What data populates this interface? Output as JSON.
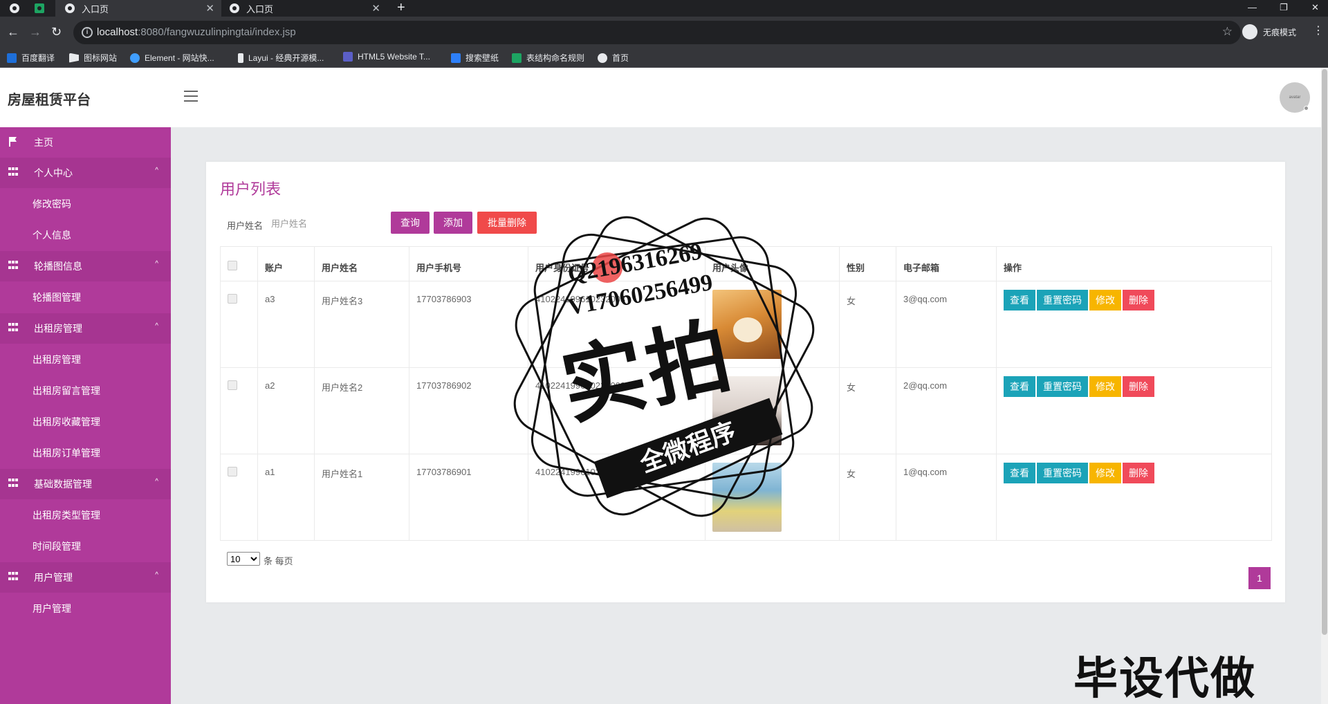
{
  "browser": {
    "tabs": [
      {
        "title": ""
      },
      {
        "title": ""
      },
      {
        "title": "入口页"
      },
      {
        "title": "入口页"
      }
    ],
    "url_host": "localhost",
    "url_rest": ":8080/fangwuzulinpingtai/index.jsp",
    "incognito_label": "无痕模式",
    "bookmarks": [
      "百度翻译",
      "图标网站",
      "Element - 网站快...",
      "Layui - 经典开源模...",
      "HTML5 Website T...",
      "搜索壁纸",
      "表结构命名规则",
      "首页"
    ]
  },
  "app": {
    "title": "房屋租赁平台",
    "avatar_text": "avatar"
  },
  "sidebar": {
    "items": [
      {
        "label": "主页",
        "type": "item",
        "icon": "flag-icon"
      },
      {
        "label": "个人中心",
        "type": "group",
        "icon": "grid-icon"
      },
      {
        "label": "修改密码",
        "type": "sub"
      },
      {
        "label": "个人信息",
        "type": "sub"
      },
      {
        "label": "轮播图信息",
        "type": "group",
        "icon": "grid-icon"
      },
      {
        "label": "轮播图管理",
        "type": "sub"
      },
      {
        "label": "出租房管理",
        "type": "group",
        "icon": "grid-icon"
      },
      {
        "label": "出租房管理",
        "type": "sub"
      },
      {
        "label": "出租房留言管理",
        "type": "sub"
      },
      {
        "label": "出租房收藏管理",
        "type": "sub"
      },
      {
        "label": "出租房订单管理",
        "type": "sub"
      },
      {
        "label": "基础数据管理",
        "type": "group",
        "icon": "grid-icon"
      },
      {
        "label": "出租房类型管理",
        "type": "sub"
      },
      {
        "label": "时间段管理",
        "type": "sub"
      },
      {
        "label": "用户管理",
        "type": "group",
        "icon": "grid-icon"
      },
      {
        "label": "用户管理",
        "type": "sub"
      }
    ]
  },
  "main": {
    "title": "用户列表",
    "search": {
      "label": "用户姓名",
      "placeholder": "用户姓名",
      "query_label": "查询",
      "add_label": "添加",
      "batch_delete_label": "批量删除"
    },
    "table": {
      "headers": [
        "",
        "账户",
        "用户姓名",
        "用户手机号",
        "用户身份证号",
        "用户头像",
        "性别",
        "电子邮箱",
        "操作"
      ],
      "rows": [
        {
          "account": "a3",
          "name": "用户姓名3",
          "phone": "17703786903",
          "idcard": "410224199610232003",
          "avatar": "dog",
          "gender": "女",
          "email": "3@qq.com"
        },
        {
          "account": "a2",
          "name": "用户姓名2",
          "phone": "17703786902",
          "idcard": "410224199610232002",
          "avatar": "girl",
          "gender": "女",
          "email": "2@qq.com"
        },
        {
          "account": "a1",
          "name": "用户姓名1",
          "phone": "17703786901",
          "idcard": "410224199610232001",
          "avatar": "beach",
          "gender": "女",
          "email": "1@qq.com"
        }
      ],
      "actions": {
        "view": "查看",
        "reset": "重置密码",
        "edit": "修改",
        "delete": "删除"
      }
    },
    "pagination": {
      "page_size": "10",
      "page_size_label": "条 每页",
      "current_page": "1"
    }
  },
  "overlay": {
    "line1": "Q2196316269",
    "line2": "V17060256499",
    "big": "实拍",
    "ribbon": "全微程序",
    "corner": "毕设代做"
  },
  "colors": {
    "accent": "#b03a9a",
    "danger": "#f04a4a",
    "info": "#1ba3b8",
    "warning": "#f7b500"
  }
}
